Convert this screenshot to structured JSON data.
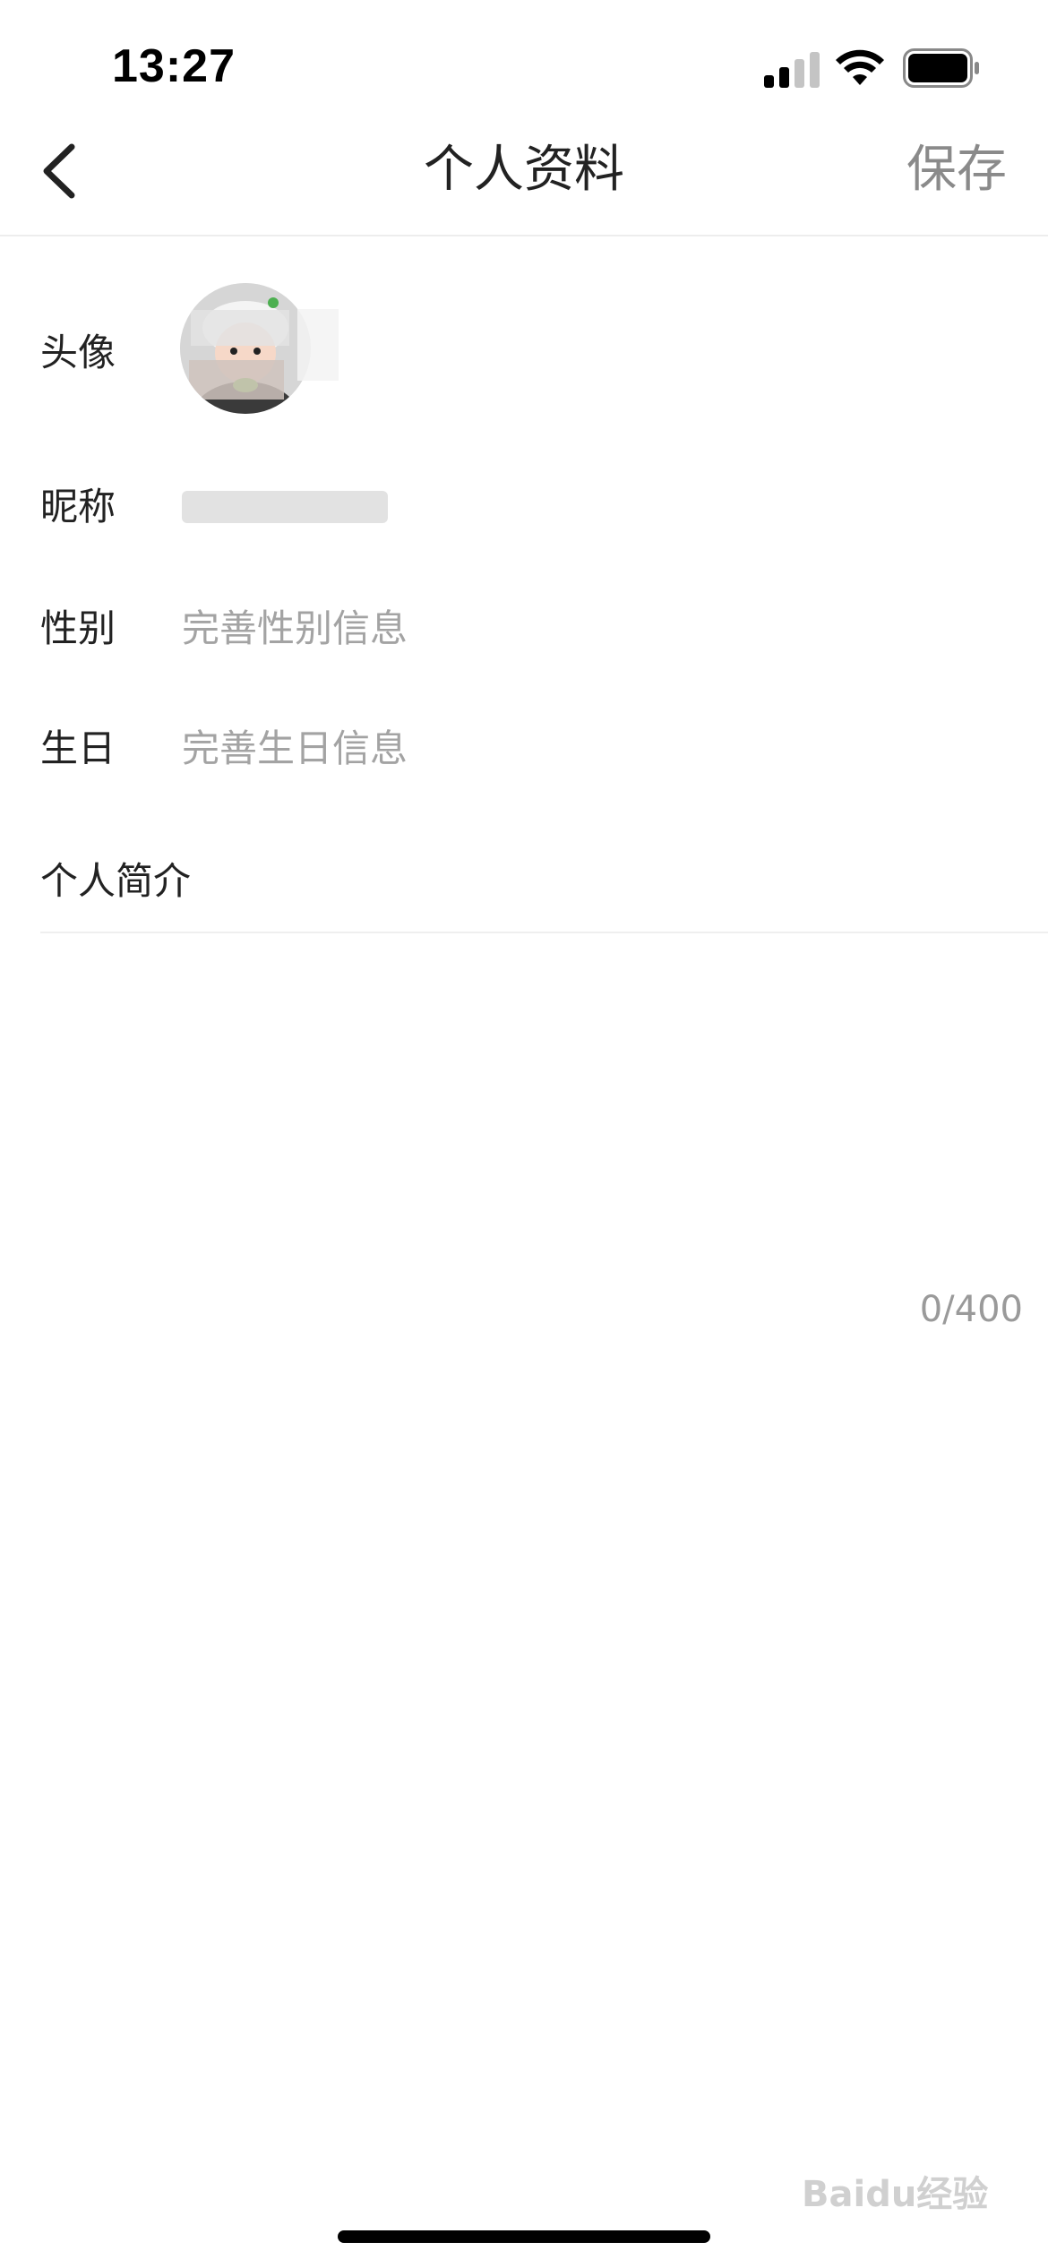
{
  "status_bar": {
    "time": "13:27",
    "signal_icon": "cellular-signal-icon",
    "wifi_icon": "wifi-icon",
    "battery_icon": "battery-full-icon"
  },
  "nav": {
    "back_icon": "chevron-left-icon",
    "title": "个人资料",
    "save_label": "保存"
  },
  "profile": {
    "avatar_label": "头像",
    "nickname_label": "昵称",
    "gender_label": "性别",
    "gender_placeholder": "完善性别信息",
    "birthday_label": "生日",
    "birthday_placeholder": "完善生日信息",
    "bio_label": "个人简介",
    "bio_counter": "0/400"
  },
  "watermark": "Baidu经验",
  "colors": {
    "text_primary": "#222222",
    "placeholder": "#a3a3a3",
    "save_disabled": "#8a8a8a",
    "divider": "#ededed"
  }
}
